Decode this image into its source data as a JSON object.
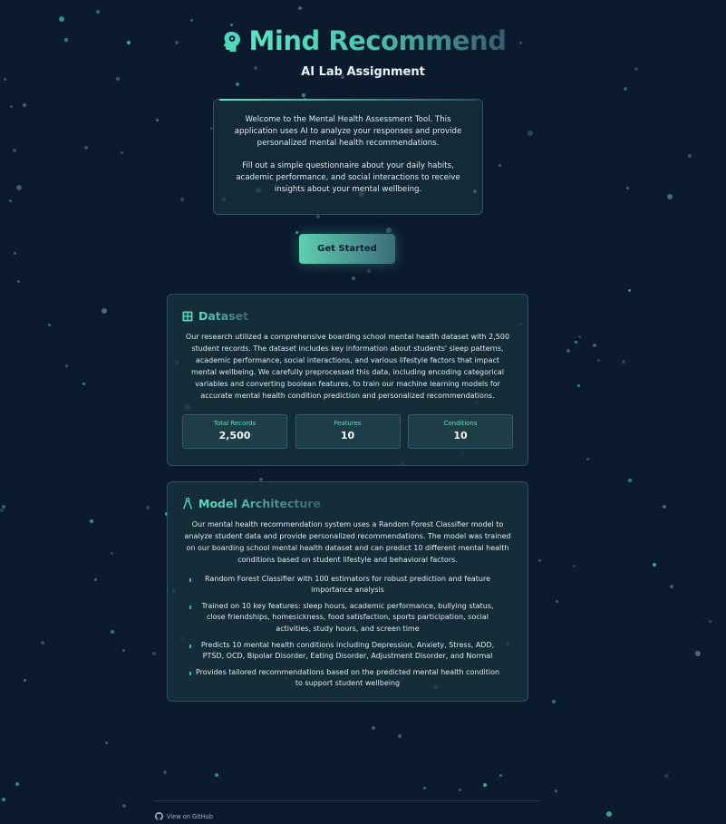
{
  "header": {
    "title": "Mind Recommend",
    "subtitle": "AI Lab Assignment"
  },
  "intro": {
    "paragraph1": "Welcome to the Mental Health Assessment Tool. This application uses AI to analyze your responses and provide personalized mental health recommendations.",
    "paragraph2": "Fill out a simple questionnaire about your daily habits, academic performance, and social interactions to receive insights about your mental wellbeing."
  },
  "cta": {
    "label": "Get Started"
  },
  "dataset": {
    "title": "Dataset",
    "description": "Our research utilized a comprehensive boarding school mental health dataset with 2,500 student records. The dataset includes key information about students' sleep patterns, academic performance, social interactions, and various lifestyle factors that impact mental wellbeing. We carefully preprocessed this data, including encoding categorical variables and converting boolean features, to train our machine learning models for accurate mental health condition prediction and personalized recommendations.",
    "stats": [
      {
        "label": "Total Records",
        "value": "2,500"
      },
      {
        "label": "Features",
        "value": "10"
      },
      {
        "label": "Conditions",
        "value": "10"
      }
    ]
  },
  "model": {
    "title": "Model Architecture",
    "description": "Our mental health recommendation system uses a Random Forest Classifier model to analyze student data and provide personalized recommendations. The model was trained on our boarding school mental health dataset and can predict 10 different mental health conditions based on student lifestyle and behavioral factors.",
    "features": [
      "Random Forest Classifier with 100 estimators for robust prediction and feature importance analysis",
      "Trained on 10 key features: sleep hours, academic performance, bullying status, close friendships, homesickness, food satisfaction, sports participation, social activities, study hours, and screen time",
      "Predicts 10 mental health conditions including Depression, Anxiety, Stress, ADD, PTSD, OCD, Bipolar Disorder, Eating Disorder, Adjustment Disorder, and Normal",
      "Provides tailored recommendations based on the predicted mental health condition to support student wellbeing"
    ]
  },
  "footer": {
    "github_label": "View on GitHub"
  },
  "colors": {
    "background": "#0b1a2d",
    "accent": "#5ee3c4",
    "card": "#18343e"
  },
  "icons": {
    "brand": "brain-gear-icon",
    "dataset": "table-icon",
    "model": "compass-icon",
    "github": "github-icon"
  }
}
